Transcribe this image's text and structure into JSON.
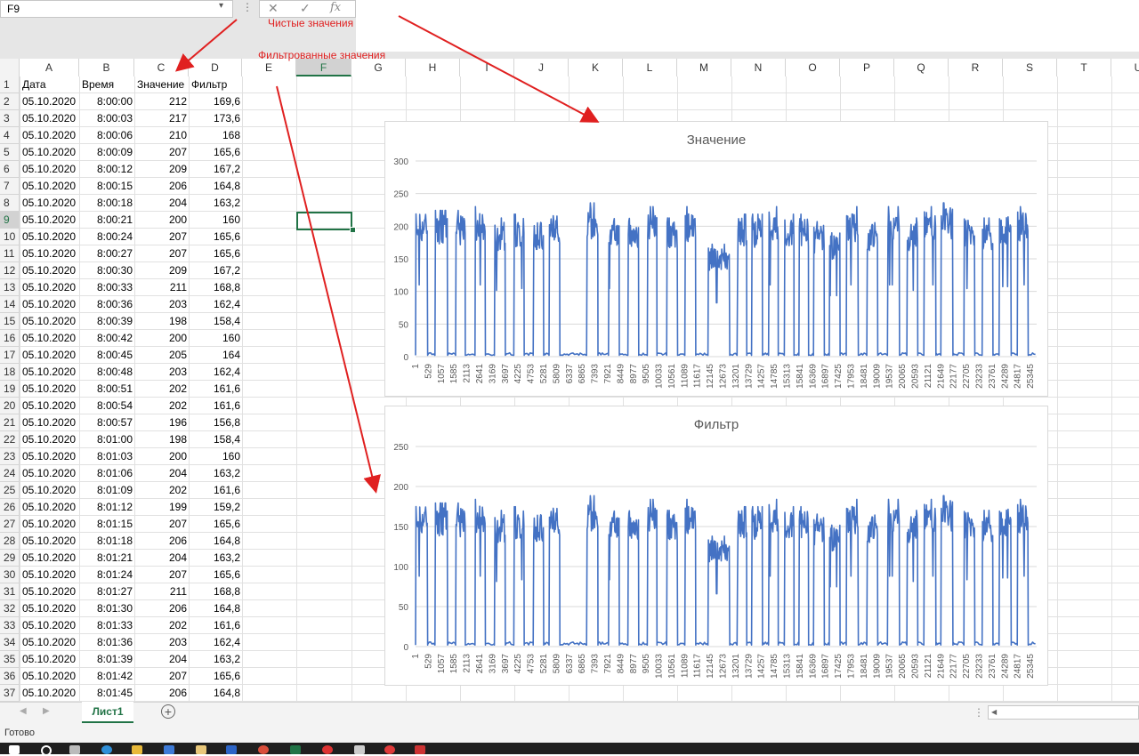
{
  "name_box": "F9",
  "formula_bar": {
    "cancel_icon": "✕",
    "enter_icon": "✓",
    "fx_label": "fx"
  },
  "columns": [
    "A",
    "B",
    "C",
    "D",
    "E",
    "F",
    "G",
    "H",
    "I",
    "J",
    "K",
    "L",
    "M",
    "N",
    "O",
    "P",
    "Q",
    "R",
    "S",
    "T",
    "U"
  ],
  "selected_column": "F",
  "selected_row": 9,
  "header_row": [
    "Дата",
    "Время",
    "Значение",
    "Фильтр"
  ],
  "rows": [
    [
      "05.10.2020",
      "8:00:00",
      "212",
      "169,6"
    ],
    [
      "05.10.2020",
      "8:00:03",
      "217",
      "173,6"
    ],
    [
      "05.10.2020",
      "8:00:06",
      "210",
      "168"
    ],
    [
      "05.10.2020",
      "8:00:09",
      "207",
      "165,6"
    ],
    [
      "05.10.2020",
      "8:00:12",
      "209",
      "167,2"
    ],
    [
      "05.10.2020",
      "8:00:15",
      "206",
      "164,8"
    ],
    [
      "05.10.2020",
      "8:00:18",
      "204",
      "163,2"
    ],
    [
      "05.10.2020",
      "8:00:21",
      "200",
      "160"
    ],
    [
      "05.10.2020",
      "8:00:24",
      "207",
      "165,6"
    ],
    [
      "05.10.2020",
      "8:00:27",
      "207",
      "165,6"
    ],
    [
      "05.10.2020",
      "8:00:30",
      "209",
      "167,2"
    ],
    [
      "05.10.2020",
      "8:00:33",
      "211",
      "168,8"
    ],
    [
      "05.10.2020",
      "8:00:36",
      "203",
      "162,4"
    ],
    [
      "05.10.2020",
      "8:00:39",
      "198",
      "158,4"
    ],
    [
      "05.10.2020",
      "8:00:42",
      "200",
      "160"
    ],
    [
      "05.10.2020",
      "8:00:45",
      "205",
      "164"
    ],
    [
      "05.10.2020",
      "8:00:48",
      "203",
      "162,4"
    ],
    [
      "05.10.2020",
      "8:00:51",
      "202",
      "161,6"
    ],
    [
      "05.10.2020",
      "8:00:54",
      "202",
      "161,6"
    ],
    [
      "05.10.2020",
      "8:00:57",
      "196",
      "156,8"
    ],
    [
      "05.10.2020",
      "8:01:00",
      "198",
      "158,4"
    ],
    [
      "05.10.2020",
      "8:01:03",
      "200",
      "160"
    ],
    [
      "05.10.2020",
      "8:01:06",
      "204",
      "163,2"
    ],
    [
      "05.10.2020",
      "8:01:09",
      "202",
      "161,6"
    ],
    [
      "05.10.2020",
      "8:01:12",
      "199",
      "159,2"
    ],
    [
      "05.10.2020",
      "8:01:15",
      "207",
      "165,6"
    ],
    [
      "05.10.2020",
      "8:01:18",
      "206",
      "164,8"
    ],
    [
      "05.10.2020",
      "8:01:21",
      "204",
      "163,2"
    ],
    [
      "05.10.2020",
      "8:01:24",
      "207",
      "165,6"
    ],
    [
      "05.10.2020",
      "8:01:27",
      "211",
      "168,8"
    ],
    [
      "05.10.2020",
      "8:01:30",
      "206",
      "164,8"
    ],
    [
      "05.10.2020",
      "8:01:33",
      "202",
      "161,6"
    ],
    [
      "05.10.2020",
      "8:01:36",
      "203",
      "162,4"
    ],
    [
      "05.10.2020",
      "8:01:39",
      "204",
      "163,2"
    ],
    [
      "05.10.2020",
      "8:01:42",
      "207",
      "165,6"
    ],
    [
      "05.10.2020",
      "8:01:45",
      "206",
      "164,8"
    ]
  ],
  "annotations": {
    "clean_values": "Чистые значения",
    "filtered_values": "Фильтрованные значения",
    "color": "#e02020"
  },
  "sheet_tab": "Лист1",
  "add_sheet_icon": "⊕",
  "status": "Готово",
  "accent_color": "#217346",
  "chart_data": [
    {
      "type": "line",
      "title": "Значение",
      "color": "#4472c4",
      "ylim": [
        0,
        300
      ],
      "yticks": [
        0,
        50,
        100,
        150,
        200,
        250,
        300
      ],
      "x_tick_labels": [
        "1",
        "529",
        "1057",
        "1585",
        "2113",
        "2641",
        "3169",
        "3697",
        "4225",
        "4753",
        "5281",
        "5809",
        "6337",
        "6865",
        "7393",
        "7921",
        "8449",
        "8977",
        "9505",
        "10033",
        "10561",
        "11089",
        "11617",
        "12145",
        "12673",
        "13201",
        "13729",
        "14257",
        "14785",
        "15313",
        "15841",
        "16369",
        "16897",
        "17425",
        "17953",
        "18481",
        "19009",
        "19537",
        "20065",
        "20593",
        "21121",
        "21649",
        "22177",
        "22705",
        "23233",
        "23761",
        "24289",
        "24817",
        "25345"
      ],
      "x_max": 25600,
      "grid": true,
      "segments": [
        {
          "start": 0,
          "end": 500,
          "level": 200
        },
        {
          "start": 800,
          "end": 1320,
          "level": 195
        },
        {
          "start": 1650,
          "end": 2050,
          "level": 195
        },
        {
          "start": 2450,
          "end": 2880,
          "level": 200
        },
        {
          "start": 3250,
          "end": 3700,
          "level": 185
        },
        {
          "start": 4050,
          "end": 4480,
          "level": 190
        },
        {
          "start": 4850,
          "end": 5280,
          "level": 185
        },
        {
          "start": 5500,
          "end": 5950,
          "level": 195
        },
        {
          "start": 7050,
          "end": 7520,
          "level": 205
        },
        {
          "start": 7950,
          "end": 8400,
          "level": 190
        },
        {
          "start": 8750,
          "end": 9200,
          "level": 190
        },
        {
          "start": 9550,
          "end": 9950,
          "level": 200
        },
        {
          "start": 10350,
          "end": 10800,
          "level": 185
        },
        {
          "start": 11100,
          "end": 11550,
          "level": 200
        },
        {
          "start": 12050,
          "end": 12950,
          "level": 150
        },
        {
          "start": 13250,
          "end": 13650,
          "level": 190
        },
        {
          "start": 13850,
          "end": 14300,
          "level": 190
        },
        {
          "start": 14550,
          "end": 14950,
          "level": 200
        },
        {
          "start": 15200,
          "end": 15600,
          "level": 190
        },
        {
          "start": 15800,
          "end": 16200,
          "level": 190
        },
        {
          "start": 16400,
          "end": 16850,
          "level": 180
        },
        {
          "start": 17050,
          "end": 17500,
          "level": 170
        },
        {
          "start": 17750,
          "end": 18250,
          "level": 200
        },
        {
          "start": 18600,
          "end": 19050,
          "level": 185
        },
        {
          "start": 19450,
          "end": 19950,
          "level": 200
        },
        {
          "start": 20250,
          "end": 20700,
          "level": 185
        },
        {
          "start": 20950,
          "end": 21450,
          "level": 200
        },
        {
          "start": 21650,
          "end": 22150,
          "level": 205
        },
        {
          "start": 22600,
          "end": 23050,
          "level": 190
        },
        {
          "start": 23350,
          "end": 23800,
          "level": 185
        },
        {
          "start": 24050,
          "end": 24550,
          "level": 195
        },
        {
          "start": 24800,
          "end": 25250,
          "level": 200
        }
      ]
    },
    {
      "type": "line",
      "title": "Фильтр",
      "color": "#4472c4",
      "ylim": [
        0,
        250
      ],
      "yticks": [
        0,
        50,
        100,
        150,
        200,
        250
      ],
      "x_tick_labels": [
        "1",
        "529",
        "1057",
        "1585",
        "2113",
        "2641",
        "3169",
        "3697",
        "4225",
        "4753",
        "5281",
        "5809",
        "6337",
        "6865",
        "7393",
        "7921",
        "8449",
        "8977",
        "9505",
        "10033",
        "10561",
        "11089",
        "11617",
        "12145",
        "12673",
        "13201",
        "13729",
        "14257",
        "14785",
        "15313",
        "15841",
        "16369",
        "16897",
        "17425",
        "17953",
        "18481",
        "19009",
        "19537",
        "20065",
        "20593",
        "21121",
        "21649",
        "22177",
        "22705",
        "23233",
        "23761",
        "24289",
        "24817",
        "25345"
      ],
      "x_max": 25600,
      "grid": true,
      "segments": [
        {
          "start": 0,
          "end": 500,
          "level": 160
        },
        {
          "start": 800,
          "end": 1320,
          "level": 156
        },
        {
          "start": 1650,
          "end": 2050,
          "level": 156
        },
        {
          "start": 2450,
          "end": 2880,
          "level": 160
        },
        {
          "start": 3250,
          "end": 3700,
          "level": 148
        },
        {
          "start": 4050,
          "end": 4480,
          "level": 152
        },
        {
          "start": 4850,
          "end": 5280,
          "level": 148
        },
        {
          "start": 5500,
          "end": 5950,
          "level": 156
        },
        {
          "start": 7050,
          "end": 7520,
          "level": 164
        },
        {
          "start": 7950,
          "end": 8400,
          "level": 152
        },
        {
          "start": 8750,
          "end": 9200,
          "level": 152
        },
        {
          "start": 9550,
          "end": 9950,
          "level": 160
        },
        {
          "start": 10350,
          "end": 10800,
          "level": 148
        },
        {
          "start": 11100,
          "end": 11550,
          "level": 160
        },
        {
          "start": 12050,
          "end": 12950,
          "level": 120
        },
        {
          "start": 13250,
          "end": 13650,
          "level": 152
        },
        {
          "start": 13850,
          "end": 14300,
          "level": 152
        },
        {
          "start": 14550,
          "end": 14950,
          "level": 160
        },
        {
          "start": 15200,
          "end": 15600,
          "level": 152
        },
        {
          "start": 15800,
          "end": 16200,
          "level": 152
        },
        {
          "start": 16400,
          "end": 16850,
          "level": 144
        },
        {
          "start": 17050,
          "end": 17500,
          "level": 136
        },
        {
          "start": 17750,
          "end": 18250,
          "level": 160
        },
        {
          "start": 18600,
          "end": 19050,
          "level": 148
        },
        {
          "start": 19450,
          "end": 19950,
          "level": 160
        },
        {
          "start": 20250,
          "end": 20700,
          "level": 148
        },
        {
          "start": 20950,
          "end": 21450,
          "level": 160
        },
        {
          "start": 21650,
          "end": 22150,
          "level": 164
        },
        {
          "start": 22600,
          "end": 23050,
          "level": 152
        },
        {
          "start": 23350,
          "end": 23800,
          "level": 148
        },
        {
          "start": 24050,
          "end": 24550,
          "level": 156
        },
        {
          "start": 24800,
          "end": 25250,
          "level": 160
        }
      ]
    }
  ]
}
